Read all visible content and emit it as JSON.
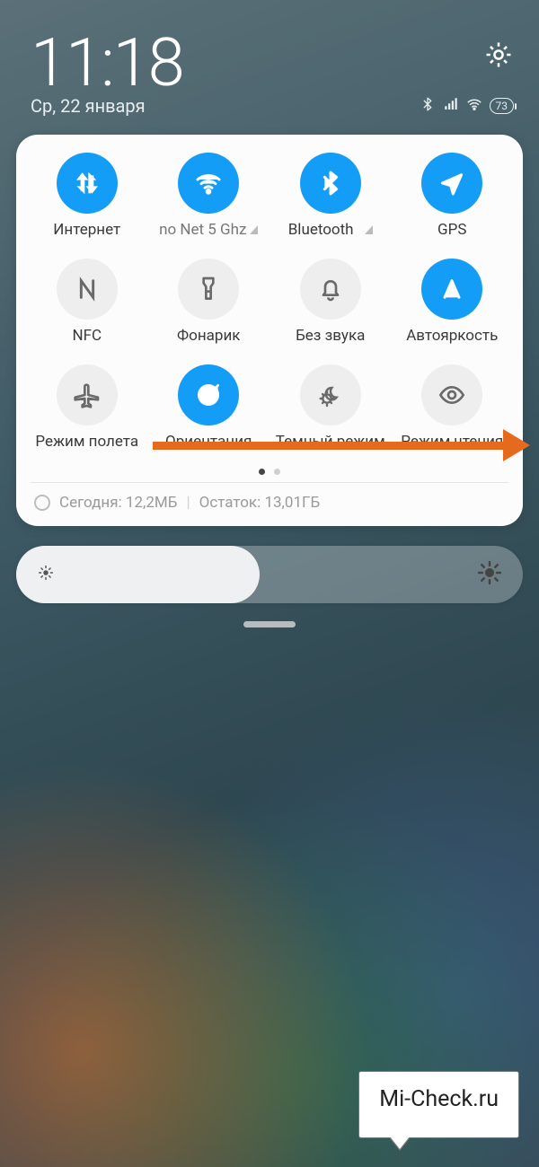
{
  "header": {
    "time": "11:18",
    "date": "Ср, 22 января",
    "battery": "73"
  },
  "tiles": [
    {
      "name": "internet",
      "label": "Интернет",
      "icon": "data-arrows",
      "active": true
    },
    {
      "name": "wifi",
      "label": "no Net 5 Ghz",
      "icon": "wifi",
      "active": true,
      "dropdown": true
    },
    {
      "name": "bluetooth",
      "label": "Bluetooth",
      "icon": "bluetooth",
      "active": true,
      "dropdown": true
    },
    {
      "name": "gps",
      "label": "GPS",
      "icon": "nav-arrow",
      "active": true
    },
    {
      "name": "nfc",
      "label": "NFC",
      "icon": "nfc",
      "active": false
    },
    {
      "name": "flashlight",
      "label": "Фонарик",
      "icon": "flashlight",
      "active": false
    },
    {
      "name": "mute",
      "label": "Без звука",
      "icon": "bell",
      "active": false
    },
    {
      "name": "auto-bright",
      "label": "Автояркость",
      "icon": "letter-a",
      "active": true
    },
    {
      "name": "airplane",
      "label": "Режим полета",
      "icon": "airplane",
      "active": false
    },
    {
      "name": "orientation",
      "label": "Ориентация",
      "icon": "rotation-lock",
      "active": true
    },
    {
      "name": "dark-mode",
      "label": "Темный режим",
      "icon": "dark-mode",
      "active": false
    },
    {
      "name": "reading-mode",
      "label": "Режим чтения",
      "icon": "eye",
      "active": false
    }
  ],
  "pager": {
    "count": 2,
    "active": 0
  },
  "usage": {
    "today_label": "Сегодня:",
    "today_value": "12,2МБ",
    "remain_label": "Остаток:",
    "remain_value": "13,01ГБ"
  },
  "brightness_percent": 48,
  "watermark": "Mi-Check.ru"
}
